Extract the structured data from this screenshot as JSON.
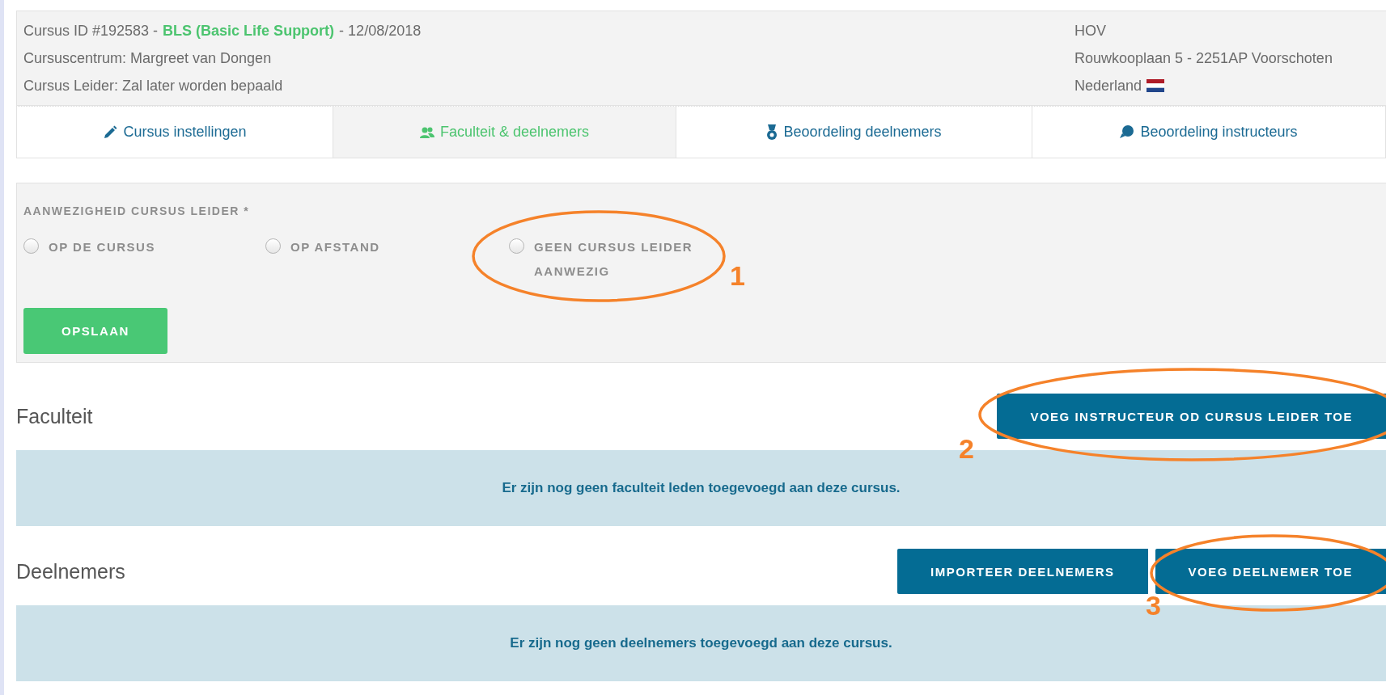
{
  "course_header": {
    "title_parts": [
      {
        "text": "Cursus ID #192583 -",
        "highlight": false
      },
      {
        "text": "BLS (Basic Life Support)",
        "highlight": true
      },
      {
        "text": "- 12/08/2018",
        "highlight": false
      }
    ],
    "center": "Cursuscentrum: Margreet van Dongen",
    "leader": "Cursus Leider: Zal later worden bepaald",
    "location": {
      "name": "HOV",
      "address": "Rouwkooplaan 5 - 2251AP Voorschoten",
      "country": "Nederland"
    }
  },
  "tabs": [
    {
      "label": "Cursus instellingen",
      "kind": "settings",
      "selected": false
    },
    {
      "label": "Faculteit & deelnemers",
      "kind": "people",
      "selected": true
    },
    {
      "label": "Beoordeling deelnemers",
      "kind": "assessment",
      "selected": false
    },
    {
      "label": "Beoordeling instructeurs",
      "kind": "feedback",
      "selected": false
    }
  ],
  "attendance": {
    "label": "AANWEZIGHEID CURSUS LEIDER *",
    "options": [
      {
        "label": "OP DE CURSUS",
        "selected": false
      },
      {
        "label": "OP AFSTAND",
        "selected": false
      },
      {
        "label": "GEEN CURSUS LEIDER AANWEZIG",
        "selected": false
      }
    ],
    "save_button": "OPSLAAN"
  },
  "sections": [
    {
      "title": "Faculteit",
      "buttons": [
        "VOEG INSTRUCTEUR OD CURSUS LEIDER TOE"
      ],
      "empty_message": "Er zijn nog geen faculteit leden toegevoegd aan deze cursus."
    },
    {
      "title": "Deelnemers",
      "buttons": [
        "IMPORTEER DEELNEMERS",
        "VOEG DEELNEMER TOE"
      ],
      "empty_message": "Er zijn nog geen deelnemers toegevoegd aan deze cursus."
    }
  ],
  "annotations": [
    {
      "number": "1"
    },
    {
      "number": "2"
    },
    {
      "number": "3"
    }
  ]
}
